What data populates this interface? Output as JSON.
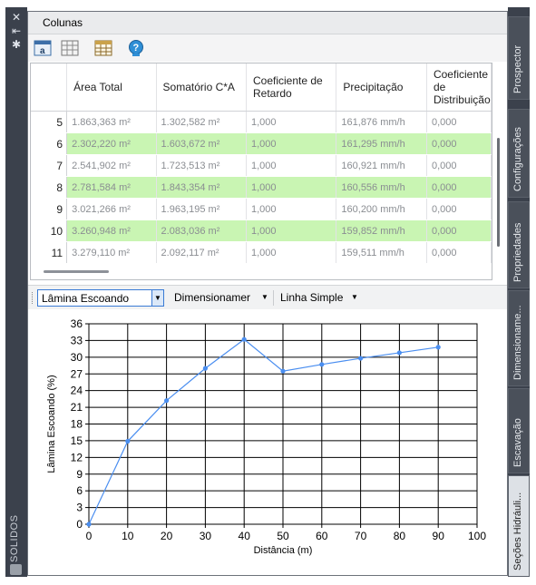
{
  "left_controls": {
    "close": "✕",
    "pin": "⇤",
    "settings": "✱"
  },
  "palette_title": "SOLIDOS",
  "panel": {
    "title": "Colunas"
  },
  "toolbar": {
    "buttons": [
      {
        "name": "text-format-icon"
      },
      {
        "name": "columns-grid-icon"
      },
      {
        "name": "table-icon"
      },
      {
        "name": "help-icon"
      }
    ]
  },
  "table": {
    "columns": [
      "",
      "Área Total",
      "Somatório C*A",
      "Coeficiente de Retardo",
      "Precipitação",
      "Coeficiente de Distribuição"
    ],
    "rows": [
      {
        "n": "5",
        "area": "1.863,363 m²",
        "soma": "1.302,582 m²",
        "ret": "1,000",
        "prec": "161,876 mm/h",
        "dist": "0,000",
        "highlight": false
      },
      {
        "n": "6",
        "area": "2.302,220 m²",
        "soma": "1.603,672 m²",
        "ret": "1,000",
        "prec": "161,295 mm/h",
        "dist": "0,000",
        "highlight": true
      },
      {
        "n": "7",
        "area": "2.541,902 m²",
        "soma": "1.723,513 m²",
        "ret": "1,000",
        "prec": "160,921 mm/h",
        "dist": "0,000",
        "highlight": false
      },
      {
        "n": "8",
        "area": "2.781,584 m²",
        "soma": "1.843,354 m²",
        "ret": "1,000",
        "prec": "160,556 mm/h",
        "dist": "0,000",
        "highlight": true
      },
      {
        "n": "9",
        "area": "3.021,266 m²",
        "soma": "1.963,195 m²",
        "ret": "1,000",
        "prec": "160,200 mm/h",
        "dist": "0,000",
        "highlight": false
      },
      {
        "n": "10",
        "area": "3.260,948 m²",
        "soma": "2.083,036 m²",
        "ret": "1,000",
        "prec": "159,852 mm/h",
        "dist": "0,000",
        "highlight": true
      },
      {
        "n": "11",
        "area": "3.279,110 m²",
        "soma": "2.092,117 m²",
        "ret": "1,000",
        "prec": "159,511 mm/h",
        "dist": "0,000",
        "highlight": false
      }
    ]
  },
  "chart_toolbar": {
    "variable": "Lâmina Escoando",
    "sizing": "Dimensionamer",
    "line_style": "Linha Simple"
  },
  "right_tabs": [
    "Prospector",
    "Configurações",
    "Propriedades",
    "Dimensioname...",
    "Escavação",
    "Seções Hidráuli..."
  ],
  "colors": {
    "highlight": "#c9f5b3",
    "line": "#4a8ef0",
    "strip": "#3b414c"
  },
  "chart_data": {
    "type": "line",
    "xlabel": "Distância  (m)",
    "ylabel": "Lâmina Escoando  (%)",
    "xlim": [
      0,
      100
    ],
    "ylim": [
      0,
      36
    ],
    "xticks": [
      0,
      10,
      20,
      30,
      40,
      50,
      60,
      70,
      80,
      90,
      100
    ],
    "yticks": [
      0,
      3,
      6,
      9,
      12,
      15,
      18,
      21,
      24,
      27,
      30,
      33,
      36
    ],
    "grid": true,
    "x": [
      0,
      10,
      20,
      30,
      40,
      50,
      60,
      70,
      80,
      90
    ],
    "y": [
      0,
      14.9,
      22.2,
      28.0,
      33.2,
      27.5,
      28.7,
      29.8,
      30.8,
      31.8
    ]
  }
}
